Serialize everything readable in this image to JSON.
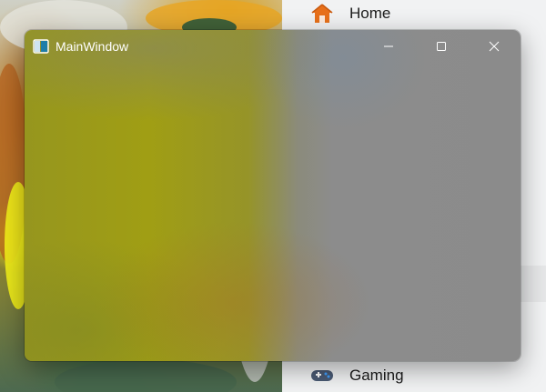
{
  "window": {
    "title": "MainWindow",
    "app_icon": "window-app-icon",
    "caption_buttons": [
      {
        "icon": "minimize-icon"
      },
      {
        "icon": "maximize-icon"
      },
      {
        "icon": "close-icon"
      }
    ]
  },
  "background_nav": {
    "items": [
      {
        "label": "Home",
        "icon": "home-icon",
        "color": "#e8701a"
      },
      {
        "label": "Gaming",
        "icon": "gamepad-icon",
        "color": "#4a5a74"
      }
    ]
  }
}
